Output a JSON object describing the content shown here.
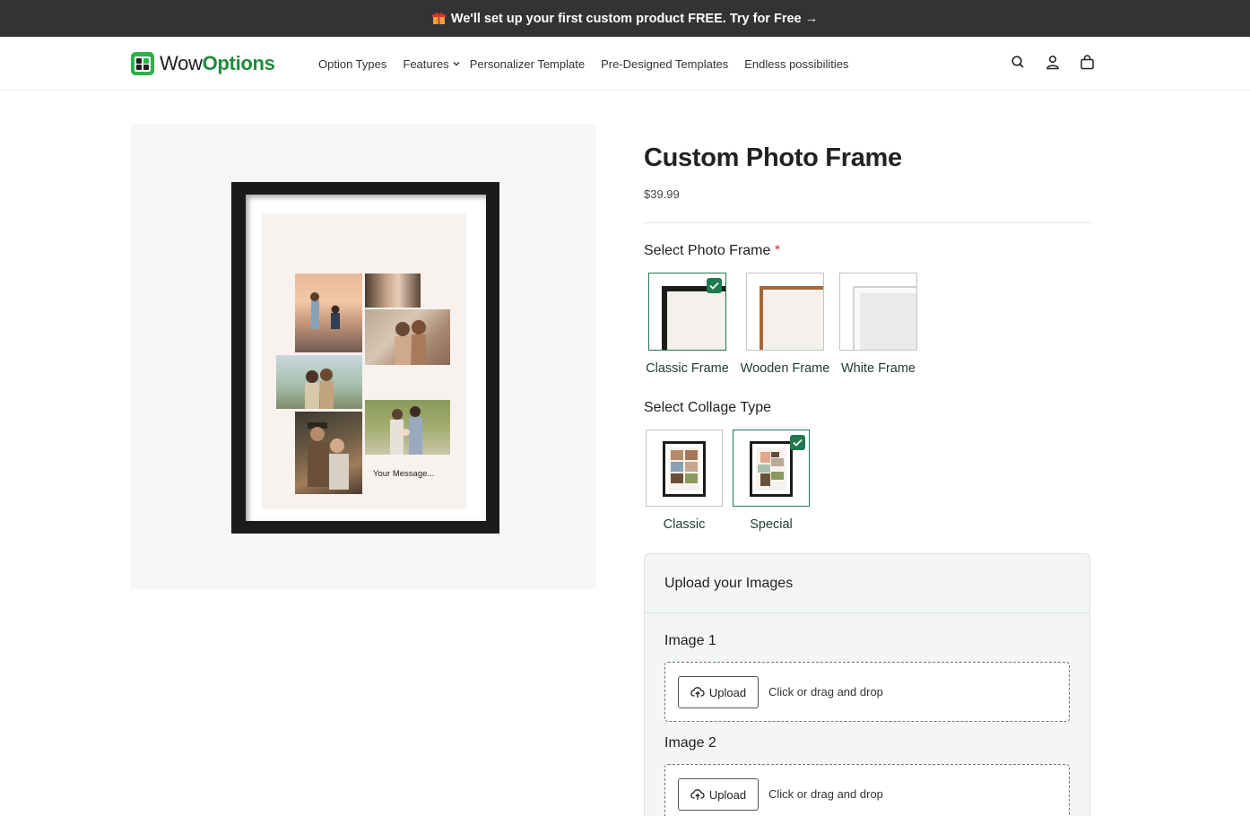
{
  "announcement": {
    "text": "We'll set up your first custom product FREE. Try for Free",
    "arrow": "→",
    "icon": "gift-icon"
  },
  "brand": {
    "name_prefix": "Wow",
    "name_suffix": "Options"
  },
  "nav": {
    "items": [
      "Option Types",
      "Features",
      "Personalizer Template",
      "Pre-Designed Templates",
      "Endless possibilities"
    ]
  },
  "header_icons": [
    "search-icon",
    "account-icon",
    "cart-icon"
  ],
  "product": {
    "title": "Custom Photo Frame",
    "price": "$39.99",
    "preview_message": "Your Message..."
  },
  "frame_option": {
    "label": "Select Photo Frame",
    "required_marker": "*",
    "choices": [
      "Classic Frame",
      "Wooden Frame",
      "White Frame"
    ],
    "selected": "Classic Frame"
  },
  "collage_option": {
    "label": "Select Collage Type",
    "choices": [
      "Classic",
      "Special"
    ],
    "selected": "Special"
  },
  "upload": {
    "heading": "Upload your Images",
    "images": [
      {
        "label": "Image 1",
        "button": "Upload",
        "hint": "Click or drag and drop"
      },
      {
        "label": "Image 2",
        "button": "Upload",
        "hint": "Click or drag and drop"
      }
    ]
  },
  "colors": {
    "accent": "#1f7a4f",
    "brand_green": "#2bb24c",
    "announcement_bg": "#333333"
  }
}
